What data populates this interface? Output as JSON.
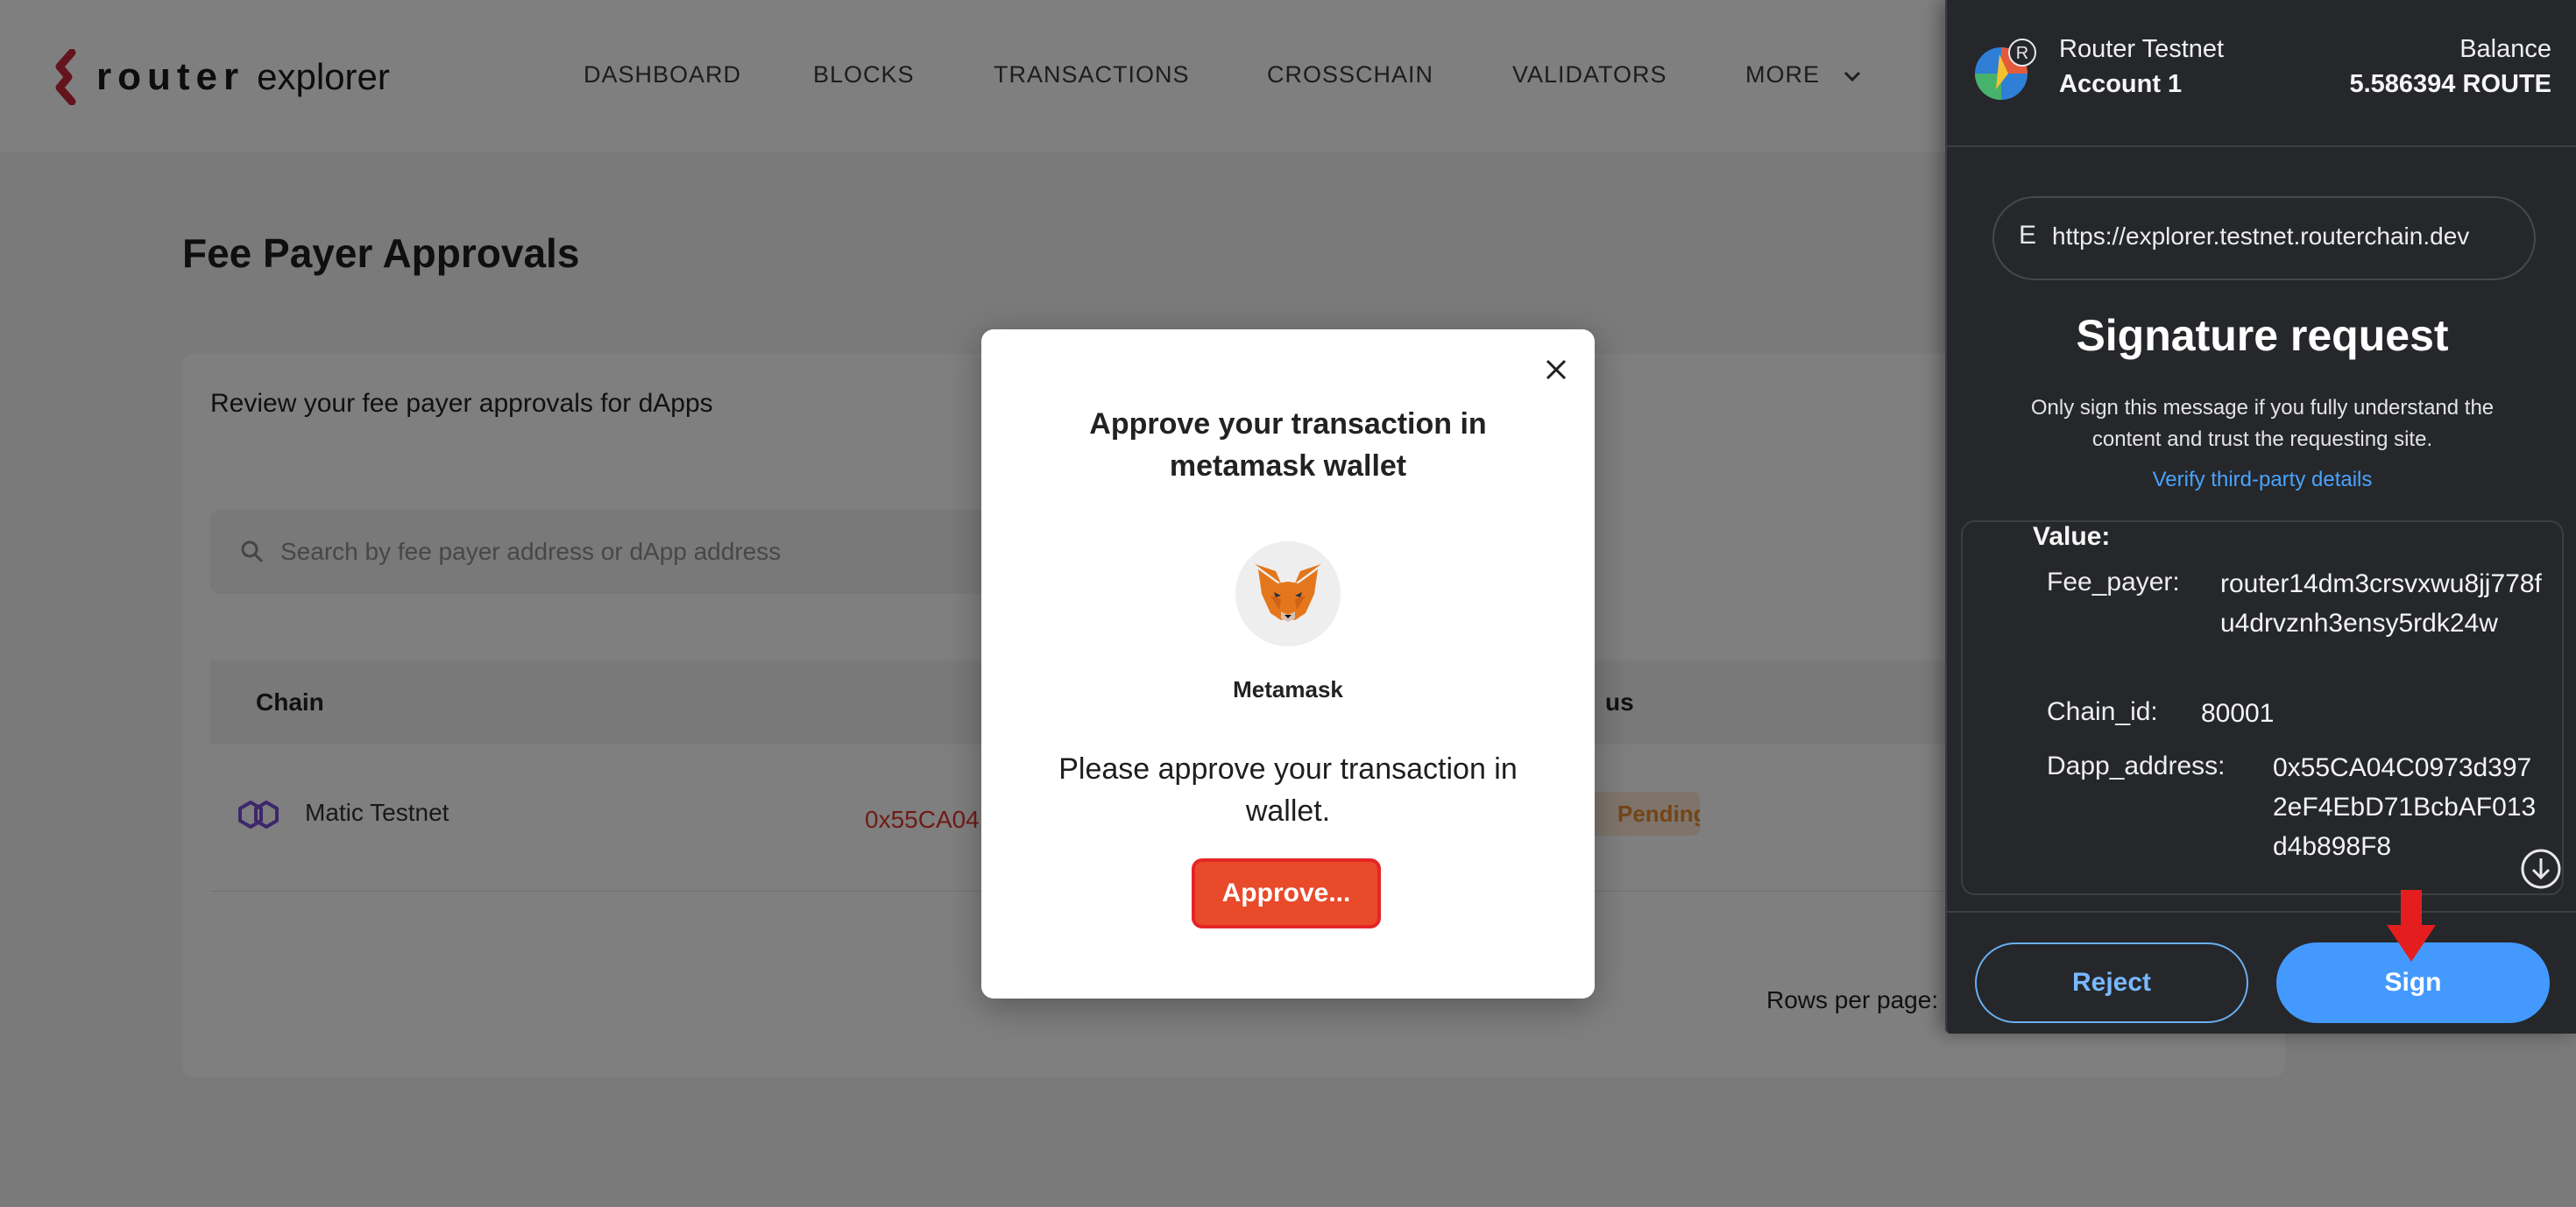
{
  "header": {
    "brand_router": "router",
    "brand_explorer": "explorer",
    "nav": [
      "DASHBOARD",
      "BLOCKS",
      "TRANSACTIONS",
      "CROSSCHAIN",
      "VALIDATORS",
      "MORE"
    ]
  },
  "page": {
    "title": "Fee Payer Approvals",
    "subtitle": "Review your fee payer approvals for dApps",
    "search_placeholder": "Search by fee payer address or dApp address",
    "table": {
      "headers": [
        "Chain",
        "us"
      ],
      "rows": [
        {
          "chain": "Matic Testnet",
          "address": "0x55CA04",
          "status": "Pending"
        }
      ]
    },
    "rows_per_page_label": "Rows per page:"
  },
  "dialog": {
    "title": "Approve your transaction in metamask wallet",
    "wallet_name": "Metamask",
    "message": "Please approve your transaction in wallet.",
    "approve_label": "Approve..."
  },
  "metamask": {
    "network": "Router Testnet",
    "account": "Account 1",
    "balance_label": "Balance",
    "balance": "5.586394 ROUTE",
    "avatar_badge": "R",
    "origin_badge": "E",
    "origin_url": "https://explorer.testnet.routerchain.dev",
    "title": "Signature request",
    "warning": "Only sign this message if you fully understand the content and trust the requesting site.",
    "verify_link": "Verify third-party details",
    "value_label": "Value:",
    "fields": [
      {
        "key": "Fee_payer:",
        "value": "router14dm3crsvxwu8jj778fu4drvznh3ensy5rdk24w"
      },
      {
        "key": "Chain_id:",
        "value": "80001"
      },
      {
        "key": "Dapp_address:",
        "value": "0x55CA04C0973d3972eF4EbD71BcbAF013d4b898F8"
      }
    ],
    "reject_label": "Reject",
    "sign_label": "Sign"
  },
  "colors": {
    "accent_red": "#e84a2a",
    "metamask_bg": "#25272a",
    "sign_blue": "#4499ff",
    "link_blue": "#4aa3ff",
    "address_red": "#e0362c"
  }
}
